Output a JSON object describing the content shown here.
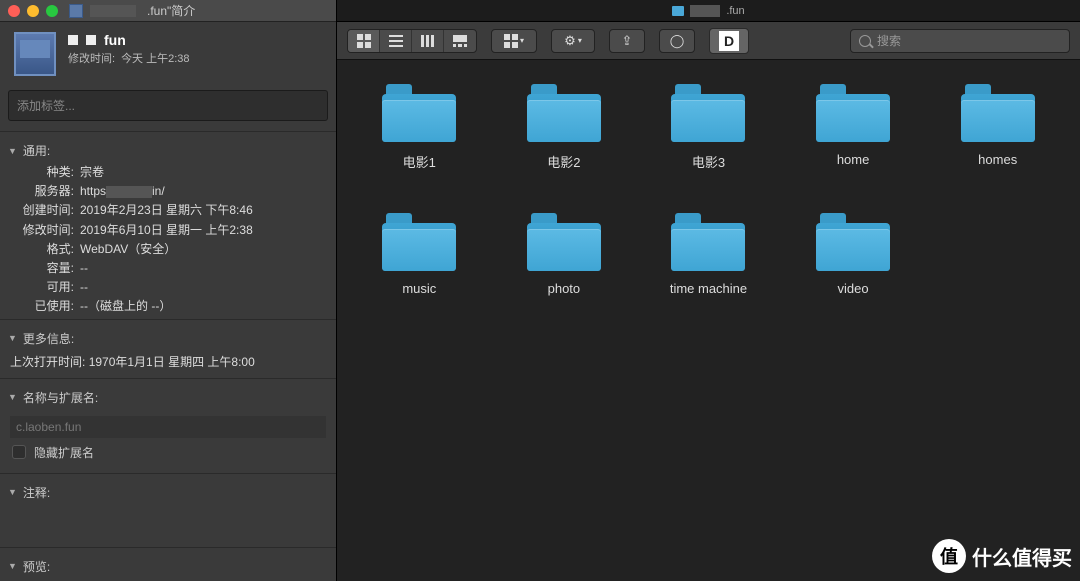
{
  "info": {
    "window_title_suffix": ".fun\"简介",
    "volume_name": "fun",
    "modified_label": "修改时间:",
    "modified_value": "今天 上午2:38",
    "tags_placeholder": "添加标签...",
    "sections": {
      "general": {
        "title": "通用:",
        "kind_label": "种类:",
        "kind_value": "宗卷",
        "server_label": "服务器:",
        "server_value_prefix": "https",
        "server_value_suffix": "in/",
        "created_label": "创建时间:",
        "created_value": "2019年2月23日 星期六 下午8:46",
        "modified_label": "修改时间:",
        "modified_value": "2019年6月10日 星期一 上午2:38",
        "format_label": "格式:",
        "format_value": "WebDAV（安全）",
        "capacity_label": "容量:",
        "capacity_value": "--",
        "available_label": "可用:",
        "available_value": "--",
        "used_label": "已使用:",
        "used_value": "--（磁盘上的 --）"
      },
      "more": {
        "title": "更多信息:",
        "last_opened_label": "上次打开时间:",
        "last_opened_value": "1970年1月1日 星期四 上午8:00"
      },
      "name_ext": {
        "title": "名称与扩展名:",
        "name_value": "c.laoben.fun",
        "hide_ext_label": "隐藏扩展名"
      },
      "comments": {
        "title": "注释:"
      },
      "preview": {
        "title": "预览:"
      }
    }
  },
  "finder": {
    "title_suffix": ".fun",
    "search_placeholder": "搜索",
    "folders": [
      {
        "name": "电影1"
      },
      {
        "name": "电影2"
      },
      {
        "name": "电影3"
      },
      {
        "name": "home"
      },
      {
        "name": "homes"
      },
      {
        "name": "music"
      },
      {
        "name": "photo"
      },
      {
        "name": "time machine"
      },
      {
        "name": "video"
      }
    ]
  },
  "watermark": "什么值得买"
}
